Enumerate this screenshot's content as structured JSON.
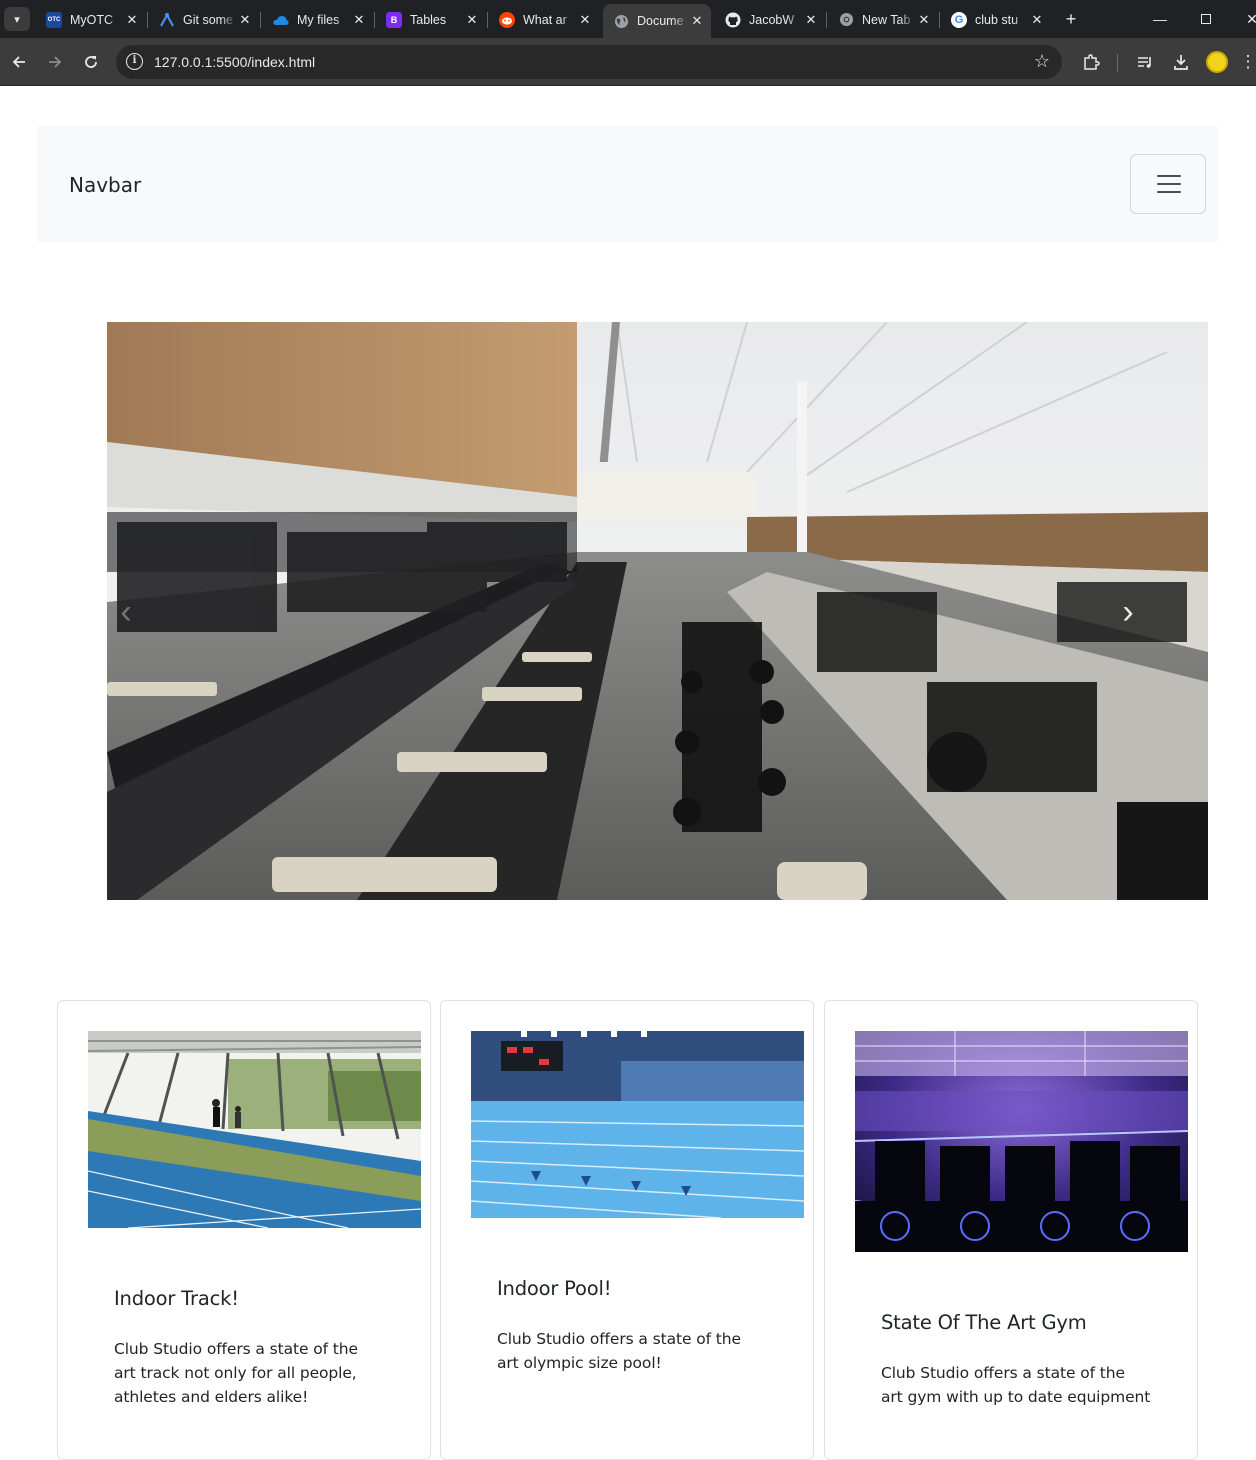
{
  "browser": {
    "tabs": [
      {
        "title": "MyOTC",
        "icon": "otc-favicon",
        "favicon_text": "OTC",
        "favicon_color": "#1a4a9c"
      },
      {
        "title": "Git some",
        "icon": "git-favicon",
        "favicon_text": "",
        "favicon_color": "#2a5db0"
      },
      {
        "title": "My files",
        "icon": "onedrive-favicon",
        "favicon_text": "",
        "favicon_color": "#1e88e5"
      },
      {
        "title": "Tables",
        "icon": "bootstrap-favicon",
        "favicon_text": "B",
        "favicon_color": "#7b2cf0"
      },
      {
        "title": "What ar",
        "icon": "reddit-favicon",
        "favicon_text": "",
        "favicon_color": "#ff4500"
      },
      {
        "title": "Docume",
        "icon": "globe-favicon",
        "favicon_text": "",
        "favicon_color": "#9aa0a6"
      },
      {
        "title": "JacobW",
        "icon": "github-favicon",
        "favicon_text": "",
        "favicon_color": "#e8eaed"
      },
      {
        "title": "New Tab",
        "icon": "chrome-favicon",
        "favicon_text": "",
        "favicon_color": "#9aa0a6"
      },
      {
        "title": "club stu",
        "icon": "google-favicon",
        "favicon_text": "G",
        "favicon_color": "#ffffff"
      }
    ],
    "active_tab_index": 5,
    "url": "127.0.0.1:5500/index.html"
  },
  "navbar": {
    "brand": "Navbar"
  },
  "carousel": {
    "prev_glyph": "‹",
    "next_glyph": "›"
  },
  "cards": [
    {
      "title": "Indoor Track!",
      "text": "Club Studio offers a state of the art track not only for all people, athletes and elders alike!"
    },
    {
      "title": "Indoor Pool!",
      "text": "Club Studio offers a state of the art olympic size pool!"
    },
    {
      "title": "State Of The Art Gym",
      "text": "Club Studio offers a state of the art gym with up to date equipment"
    }
  ],
  "colors": {
    "chrome_dark": "#202124",
    "chrome_toolbar": "#3c3c3c",
    "navbar_bg": "#f8f9fa",
    "text": "#212529"
  }
}
